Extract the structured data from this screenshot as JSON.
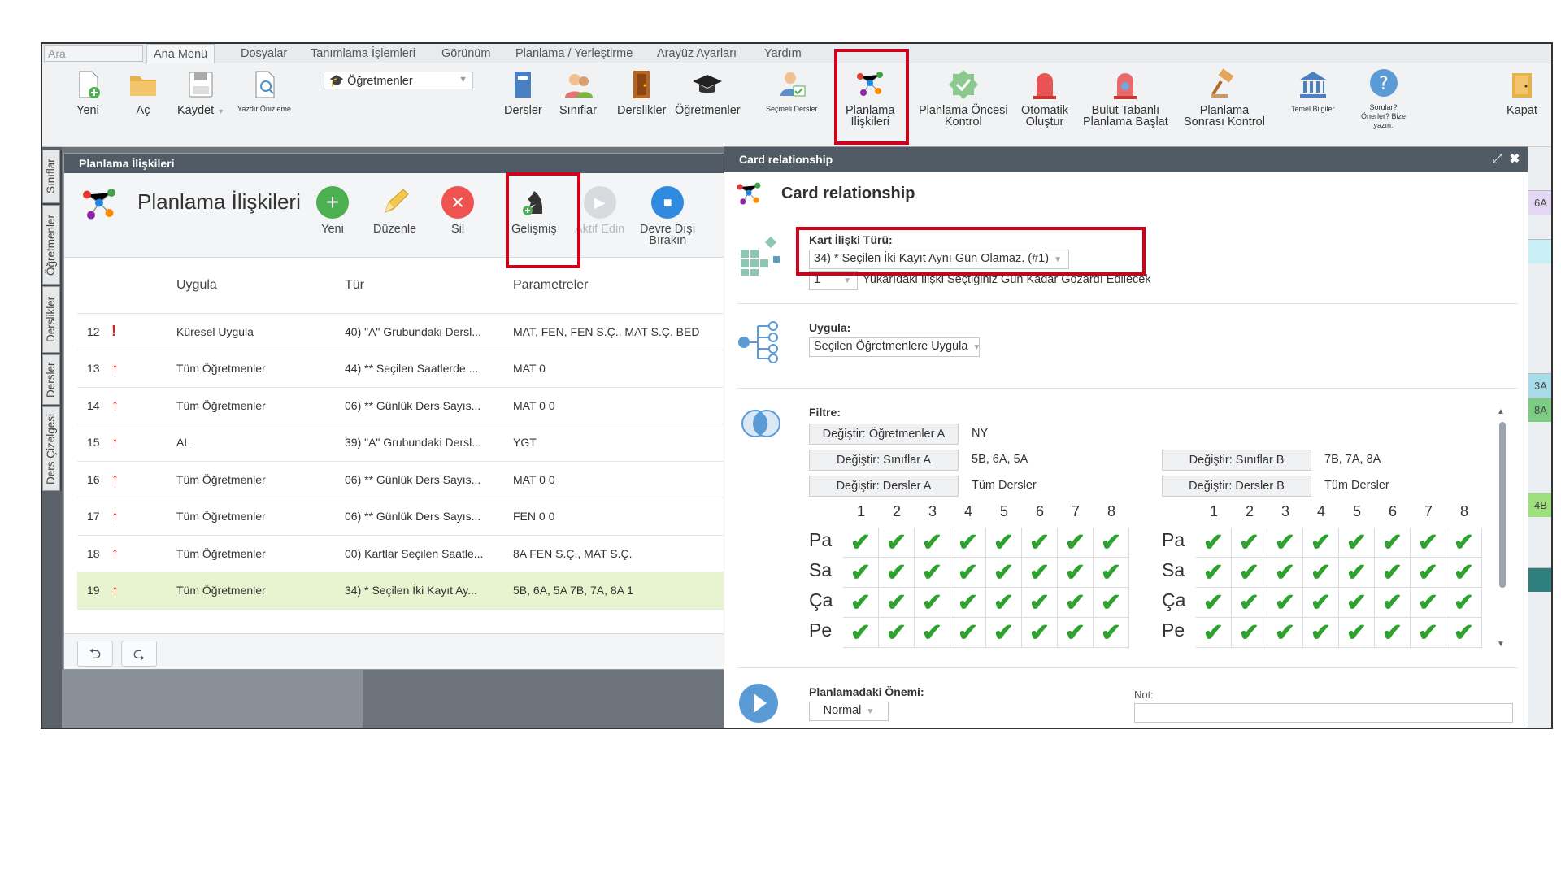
{
  "menubar": {
    "search_placeholder": "Ara",
    "tabs": [
      "Ana Menü",
      "Dosyalar",
      "Tanımlama İşlemleri",
      "Görünüm",
      "Planlama / Yerleştirme",
      "Arayüz Ayarları",
      "Yardım"
    ]
  },
  "ribbon": {
    "new": "Yeni",
    "open": "Aç",
    "save": "Kaydet",
    "print_preview": "Yazdır Önizleme",
    "dropdown_value": "Öğretmenler",
    "lessons": "Dersler",
    "classes": "Sınıflar",
    "rooms": "Derslikler",
    "teachers": "Öğretmenler",
    "elective": "Seçmeli Dersler",
    "planning_rel_1": "Planlama",
    "planning_rel_2": "İlişkileri",
    "precheck_1": "Planlama Öncesi",
    "precheck_2": "Kontrol",
    "auto_1": "Otomatik",
    "auto_2": "Oluştur",
    "cloud_1": "Bulut Tabanlı",
    "cloud_2": "Planlama Başlat",
    "postcheck_1": "Planlama",
    "postcheck_2": "Sonrası Kontrol",
    "basic": "Temel Bilgiler",
    "questions_1": "Sorular?",
    "questions_2": "Önerler? Bize",
    "questions_3": "yazın.",
    "close": "Kapat"
  },
  "vtabs": [
    "Sınıflar",
    "Öğretmenler",
    "Derslikler",
    "Dersler",
    "Ders Çizelgesi"
  ],
  "right_cells": [
    "6A",
    "3A",
    "8A",
    "4B"
  ],
  "left_panel": {
    "window_title": "Planlama İlişkileri",
    "heading": "Planlama İlişkileri",
    "btn_new": "Yeni",
    "btn_edit": "Düzenle",
    "btn_delete": "Sil",
    "btn_advanced": "Gelişmiş",
    "btn_activate": "Aktif Edin",
    "btn_disable_1": "Devre Dışı",
    "btn_disable_2": "Bırakın",
    "columns": [
      "",
      "",
      "Uygula",
      "Tür",
      "Parametreler"
    ],
    "rows": [
      {
        "num": "12",
        "icon": "!",
        "apply": "Küresel Uygula",
        "type": "40) \"A\" Grubundaki Dersl...",
        "params": "MAT, FEN, FEN S.Ç., MAT S.Ç. BED"
      },
      {
        "num": "13",
        "icon": "↑",
        "apply": "Tüm Öğretmenler",
        "type": "44) ** Seçilen Saatlerde ...",
        "params": "MAT 0"
      },
      {
        "num": "14",
        "icon": "↑",
        "apply": "Tüm Öğretmenler",
        "type": "06) ** Günlük Ders Sayıs...",
        "params": "MAT 0 0"
      },
      {
        "num": "15",
        "icon": "↑",
        "apply": "AL",
        "type": "39) \"A\" Grubundaki Dersl...",
        "params": "YGT"
      },
      {
        "num": "16",
        "icon": "↑",
        "apply": "Tüm Öğretmenler",
        "type": "06) ** Günlük Ders Sayıs...",
        "params": "MAT 0 0"
      },
      {
        "num": "17",
        "icon": "↑",
        "apply": "Tüm Öğretmenler",
        "type": "06) ** Günlük Ders Sayıs...",
        "params": "FEN 0 0"
      },
      {
        "num": "18",
        "icon": "↑",
        "apply": "Tüm Öğretmenler",
        "type": "00) Kartlar Seçilen Saatle...",
        "params": "8A FEN S.Ç., MAT S.Ç."
      },
      {
        "num": "19",
        "icon": "↑",
        "apply": "Tüm Öğretmenler",
        "type": "34) * Seçilen İki Kayıt Ay...",
        "params": "5B, 6A, 5A 7B, 7A, 8A 1"
      }
    ],
    "undo": "⮌",
    "redo": "⮎"
  },
  "right_panel": {
    "window_title": "Card relationship",
    "heading": "Card relationship",
    "type_label": "Kart İlişki Türü:",
    "type_value": "34) * Seçilen İki Kayıt Aynı Gün Olamaz. (#1)",
    "days_value": "1",
    "days_text": "Yukarıdaki İlişki Seçtiğiniz Gün Kadar Gözardı Edilecek",
    "apply_label": "Uygula:",
    "apply_value": "Seçilen Öğretmenlere Uygula",
    "filter_label": "Filtre:",
    "filters_left": [
      {
        "btn": "Değiştir: Öğretmenler A",
        "value": "NY"
      },
      {
        "btn": "Değiştir: Sınıflar A",
        "value": "5B, 6A, 5A"
      },
      {
        "btn": "Değiştir: Dersler A",
        "value": "Tüm Dersler"
      }
    ],
    "filters_right": [
      {
        "btn": "Değiştir: Sınıflar B",
        "value": "7B, 7A, 8A"
      },
      {
        "btn": "Değiştir: Dersler B",
        "value": "Tüm Dersler"
      }
    ],
    "grid_cols": [
      "1",
      "2",
      "3",
      "4",
      "5",
      "6",
      "7",
      "8"
    ],
    "grid_rows": [
      "Pa",
      "Sa",
      "Ça",
      "Pe"
    ],
    "check": "✔",
    "importance_label": "Planlamadaki Önemi:",
    "importance_value": "Normal",
    "note_label": "Not:"
  },
  "colors": {
    "accent_red": "#d0021b",
    "check_green": "#2ea12e",
    "titlebar": "#505b66",
    "selected_row": "#e8f3cf"
  }
}
